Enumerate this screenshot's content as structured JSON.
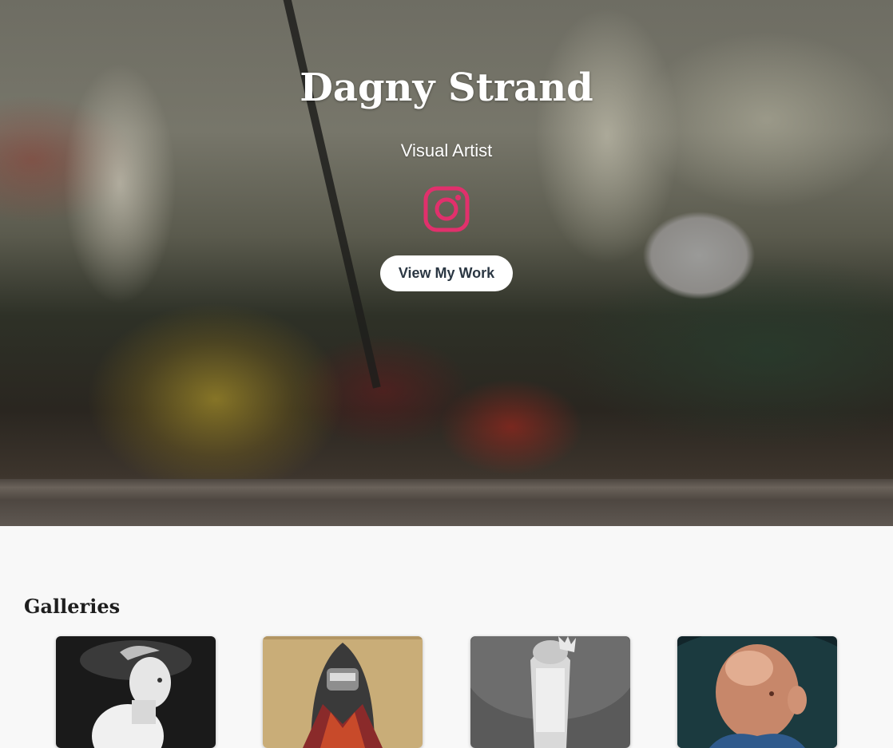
{
  "hero": {
    "title": "Dagny Strand",
    "subtitle": "Visual Artist",
    "social_icon": "instagram-icon",
    "cta_label": "View My Work"
  },
  "galleries": {
    "heading": "Galleries",
    "items": [
      {
        "thumbnail": "pale-figure-painting"
      },
      {
        "thumbnail": "hooded-figure-painting"
      },
      {
        "thumbnail": "swaddled-baby-painting"
      },
      {
        "thumbnail": "bald-man-portrait"
      }
    ]
  },
  "colors": {
    "instagram_accent": "#e1306c",
    "button_text": "#2b3743",
    "page_background": "#f8f8f8"
  }
}
